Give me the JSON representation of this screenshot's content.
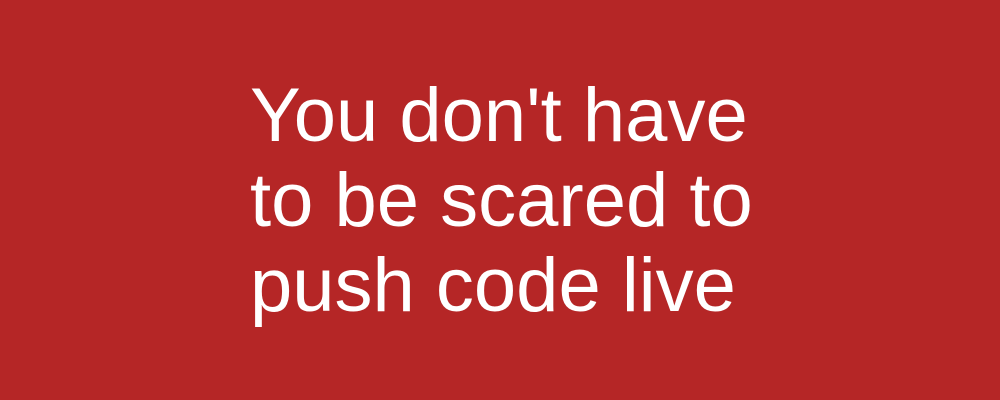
{
  "banner": {
    "background_color": "#b52626",
    "text_color": "#ffffff",
    "lines": [
      "You don't have",
      "to be scared to",
      "push code live"
    ]
  }
}
